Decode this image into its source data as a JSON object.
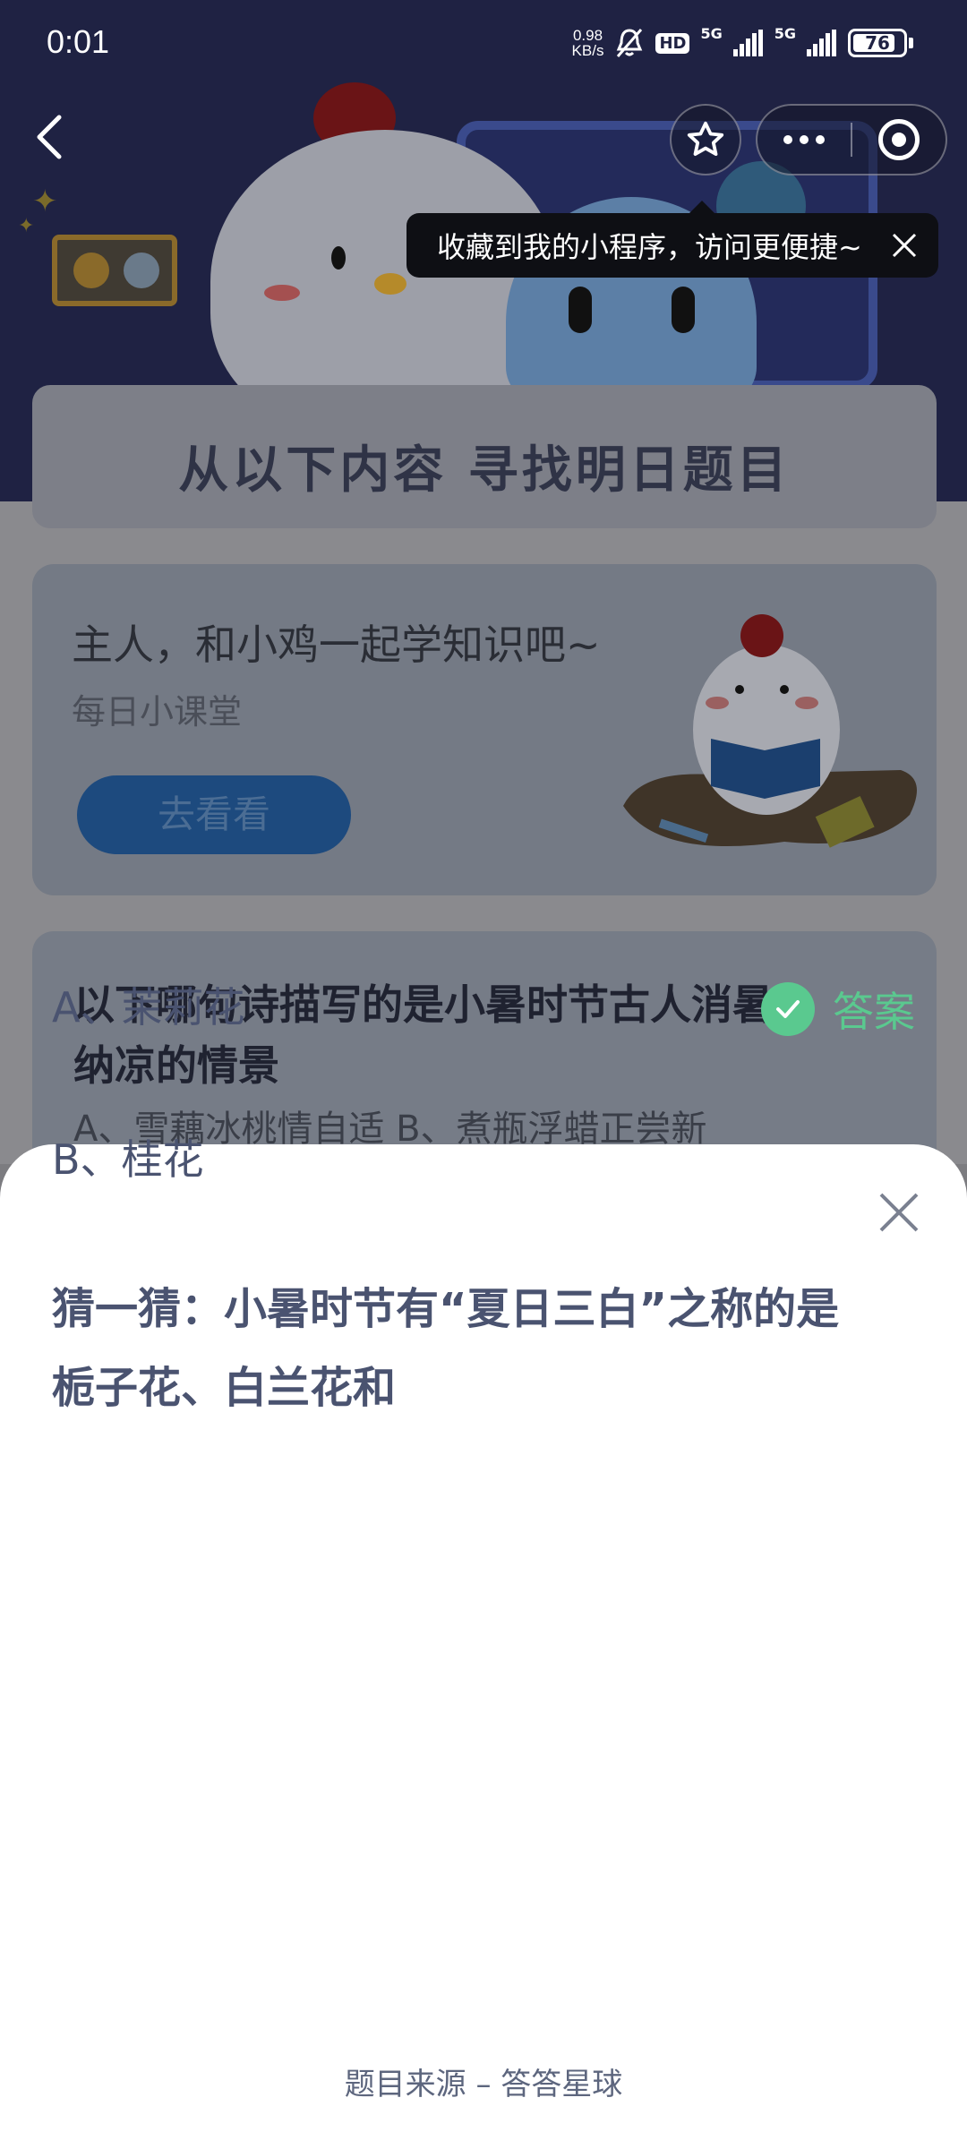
{
  "status_bar": {
    "time": "0:01",
    "net_speed_value": "0.98",
    "net_speed_unit": "KB/s",
    "hd_badge": "HD",
    "signal_1": "5G",
    "signal_2": "5G",
    "battery_level": "76"
  },
  "tooltip": {
    "text": "收藏到我的小程序，访问更便捷~"
  },
  "background": {
    "banner_title": "从以下内容  寻找明日题目",
    "lesson_card": {
      "title": "主人，和小鸡一起学知识吧~",
      "subtitle": "每日小课堂",
      "button_label": "去看看"
    },
    "quiz_card": {
      "question_line1": "以下哪句诗描写的是小暑时节古人消暑",
      "question_line2": "纳凉的情景",
      "options_preview": "A、雪藕冰桃情自适     B、煮瓶浮蜡正尝新"
    }
  },
  "sheet": {
    "question_line1": "猜一猜：小暑时节有“夏日三白”之称的是",
    "question_line2": "栀子花、白兰花和",
    "options": [
      {
        "label": "A、茉莉花",
        "answer_tag": "答案"
      },
      {
        "label": "B、桂花"
      }
    ],
    "source": "题目来源 – 答答星球"
  },
  "colors": {
    "question_text": "#4a5370",
    "answer_green": "#5ac98f",
    "tooltip_bg": "#0e0f14",
    "hero_bg": "#1f2243"
  }
}
